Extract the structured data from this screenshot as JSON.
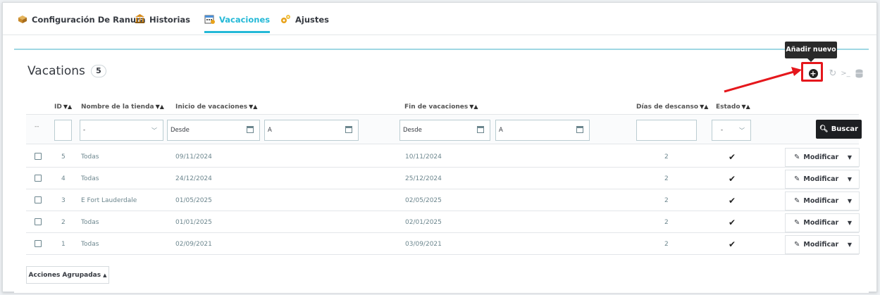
{
  "tabs": [
    {
      "label": "Configuración De Ranura",
      "icon": "box-icon",
      "color": "#c98a2b"
    },
    {
      "label": "Historias",
      "icon": "bank-icon",
      "color": "#d68a1a"
    },
    {
      "label": "Vacaciones",
      "icon": "calendar-icon",
      "color": "#4a90d9"
    },
    {
      "label": "Ajustes",
      "icon": "gears-icon",
      "color": "#e8a21a"
    }
  ],
  "active_tab": "Vacaciones",
  "panel": {
    "title": "Vacations",
    "count": "5",
    "tooltip": "Añadir nuevo",
    "toolbar_icons": [
      "add-new-icon",
      "refresh-icon",
      "sql-terminal-icon",
      "database-icon"
    ]
  },
  "columns": {
    "id": "ID",
    "store": "Nombre de la tienda",
    "start": "Inicio de vacaciones",
    "end": "Fin de vacaciones",
    "days": "Días de descanso",
    "status": "Estado"
  },
  "filters": {
    "dashes": "--",
    "store_value": "-",
    "start_from": "Desde",
    "start_to": "A",
    "end_from": "Desde",
    "end_to": "A",
    "status_value": "-",
    "search_label": "Buscar"
  },
  "rows": [
    {
      "id": "5",
      "store": "Todas",
      "start": "09/11/2024",
      "end": "10/11/2024",
      "days": "2",
      "edit": "Modificar"
    },
    {
      "id": "4",
      "store": "Todas",
      "start": "24/12/2024",
      "end": "25/12/2024",
      "days": "2",
      "edit": "Modificar"
    },
    {
      "id": "3",
      "store": "E Fort Lauderdale",
      "start": "01/05/2025",
      "end": "02/05/2025",
      "days": "2",
      "edit": "Modificar"
    },
    {
      "id": "2",
      "store": "Todas",
      "start": "01/01/2025",
      "end": "02/01/2025",
      "days": "2",
      "edit": "Modificar"
    },
    {
      "id": "1",
      "store": "Todas",
      "start": "02/09/2021",
      "end": "03/09/2021",
      "days": "2",
      "edit": "Modificar"
    }
  ],
  "bulk_label": "Acciones Agrupadas",
  "colors": {
    "accent": "#25b9d7",
    "highlight": "#e5171c",
    "dark_button": "#1d1f22"
  }
}
